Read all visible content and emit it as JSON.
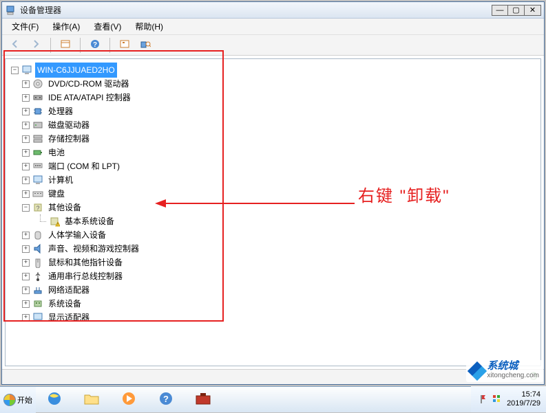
{
  "window": {
    "title": "设备管理器",
    "buttons": {
      "min": "—",
      "max": "▢",
      "close": "✕"
    }
  },
  "menu": {
    "file": "文件(F)",
    "action": "操作(A)",
    "view": "查看(V)",
    "help": "帮助(H)"
  },
  "toolbar": {
    "back": "back",
    "fwd": "fwd",
    "props": "props",
    "help": "help",
    "scan": "scan",
    "showhidden": "showhidden"
  },
  "tree": {
    "root": "WIN-C6JJUAED2HO",
    "items": [
      {
        "exp": "+",
        "icon": "disc",
        "label": "DVD/CD-ROM 驱动器"
      },
      {
        "exp": "+",
        "icon": "ide",
        "label": "IDE ATA/ATAPI 控制器"
      },
      {
        "exp": "+",
        "icon": "cpu",
        "label": "处理器"
      },
      {
        "exp": "+",
        "icon": "hdd",
        "label": "磁盘驱动器"
      },
      {
        "exp": "+",
        "icon": "storage",
        "label": "存储控制器"
      },
      {
        "exp": "+",
        "icon": "battery",
        "label": "电池"
      },
      {
        "exp": "+",
        "icon": "port",
        "label": "端口 (COM 和 LPT)"
      },
      {
        "exp": "+",
        "icon": "pc",
        "label": "计算机"
      },
      {
        "exp": "+",
        "icon": "kbd",
        "label": "键盘"
      },
      {
        "exp": "−",
        "icon": "other",
        "label": "其他设备"
      },
      {
        "exp": "",
        "icon": "warn",
        "label": "基本系统设备",
        "child": true
      },
      {
        "exp": "+",
        "icon": "hid",
        "label": "人体学输入设备"
      },
      {
        "exp": "+",
        "icon": "sound",
        "label": "声音、视频和游戏控制器"
      },
      {
        "exp": "+",
        "icon": "mouse",
        "label": "鼠标和其他指针设备"
      },
      {
        "exp": "+",
        "icon": "usb",
        "label": "通用串行总线控制器"
      },
      {
        "exp": "+",
        "icon": "net",
        "label": "网络适配器"
      },
      {
        "exp": "+",
        "icon": "system",
        "label": "系统设备"
      },
      {
        "exp": "+",
        "icon": "display",
        "label": "显示适配器"
      }
    ]
  },
  "annotation": {
    "text": "右键 \"卸载\""
  },
  "taskbar": {
    "start": "开始",
    "time1": "15:74",
    "time2": "2019/7/29"
  },
  "watermark": {
    "site": "系统城",
    "url": "xitongcheng.com"
  },
  "colors": {
    "accent": "#3399ff",
    "annotation": "#e62020"
  }
}
